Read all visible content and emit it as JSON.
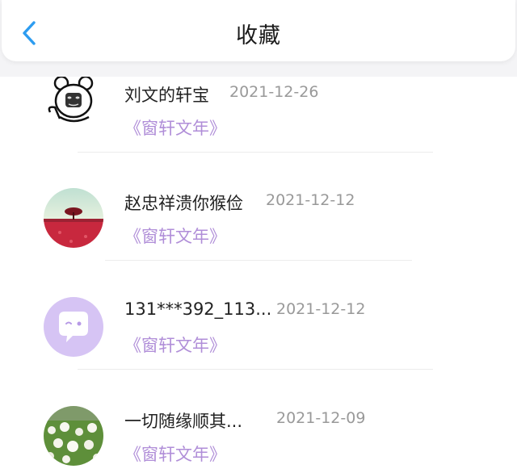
{
  "header": {
    "title": "收藏",
    "back_icon": "chevron-left-icon",
    "accent_color": "#2d9cf0"
  },
  "favorites": [
    {
      "name": "刘文的轩宝",
      "date": "2021-12-26",
      "book": "《窗轩文年》",
      "avatar": "meme-bear-avatar"
    },
    {
      "name": "赵忠祥溃你猴俭",
      "date": "2021-12-12",
      "book": "《窗轩文年》",
      "avatar": "red-field-tree-avatar"
    },
    {
      "name": "131***392_113...",
      "date": "2021-12-12",
      "book": "《窗轩文年》",
      "avatar": "chat-bubble-avatar"
    },
    {
      "name": "一切随缘顺其...",
      "date": "2021-12-09",
      "book": "《窗轩文年》",
      "avatar": "dandelion-field-avatar"
    }
  ],
  "colors": {
    "book_title": "#b08ed8",
    "date_text": "#999999",
    "avatar_lavender": "#d6c4f4"
  }
}
